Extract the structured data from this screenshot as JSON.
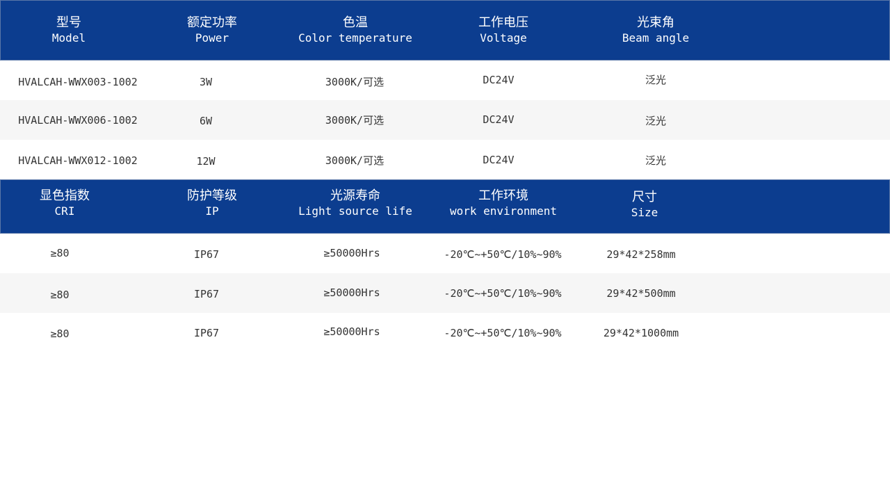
{
  "table1": {
    "headers": [
      {
        "zh": "型号",
        "en": "Model"
      },
      {
        "zh": "额定功率",
        "en": "Power"
      },
      {
        "zh": "色温",
        "en": "Color temperature"
      },
      {
        "zh": "工作电压",
        "en": "Voltage"
      },
      {
        "zh": "光束角",
        "en": "Beam angle"
      }
    ],
    "rows": [
      [
        "HVALCAH-WWX003-1002",
        "3W",
        "3000K/可选",
        "DC24V",
        "泛光"
      ],
      [
        "HVALCAH-WWX006-1002",
        "6W",
        "3000K/可选",
        "DC24V",
        "泛光"
      ],
      [
        "HVALCAH-WWX012-1002",
        "12W",
        "3000K/可选",
        "DC24V",
        "泛光"
      ]
    ]
  },
  "table2": {
    "headers": [
      {
        "zh": "显色指数",
        "en": "CRI"
      },
      {
        "zh": "防护等级",
        "en": "IP"
      },
      {
        "zh": "光源寿命",
        "en": "Light source life"
      },
      {
        "zh": "工作环境",
        "en": "work environment"
      },
      {
        "zh": "尺寸",
        "en": "Size"
      }
    ],
    "rows": [
      [
        "≥80",
        "IP67",
        "≥50000Hrs",
        "-20℃~+50℃/10%~90%",
        "29*42*258mm"
      ],
      [
        "≥80",
        "IP67",
        "≥50000Hrs",
        "-20℃~+50℃/10%~90%",
        "29*42*500mm"
      ],
      [
        "≥80",
        "IP67",
        "≥50000Hrs",
        "-20℃~+50℃/10%~90%",
        "29*42*1000mm"
      ]
    ]
  },
  "colors": {
    "header_bg": "#0c3d8f",
    "header_text": "#ffffff",
    "row_alt_bg": "#f6f6f6",
    "body_text": "#333333"
  }
}
